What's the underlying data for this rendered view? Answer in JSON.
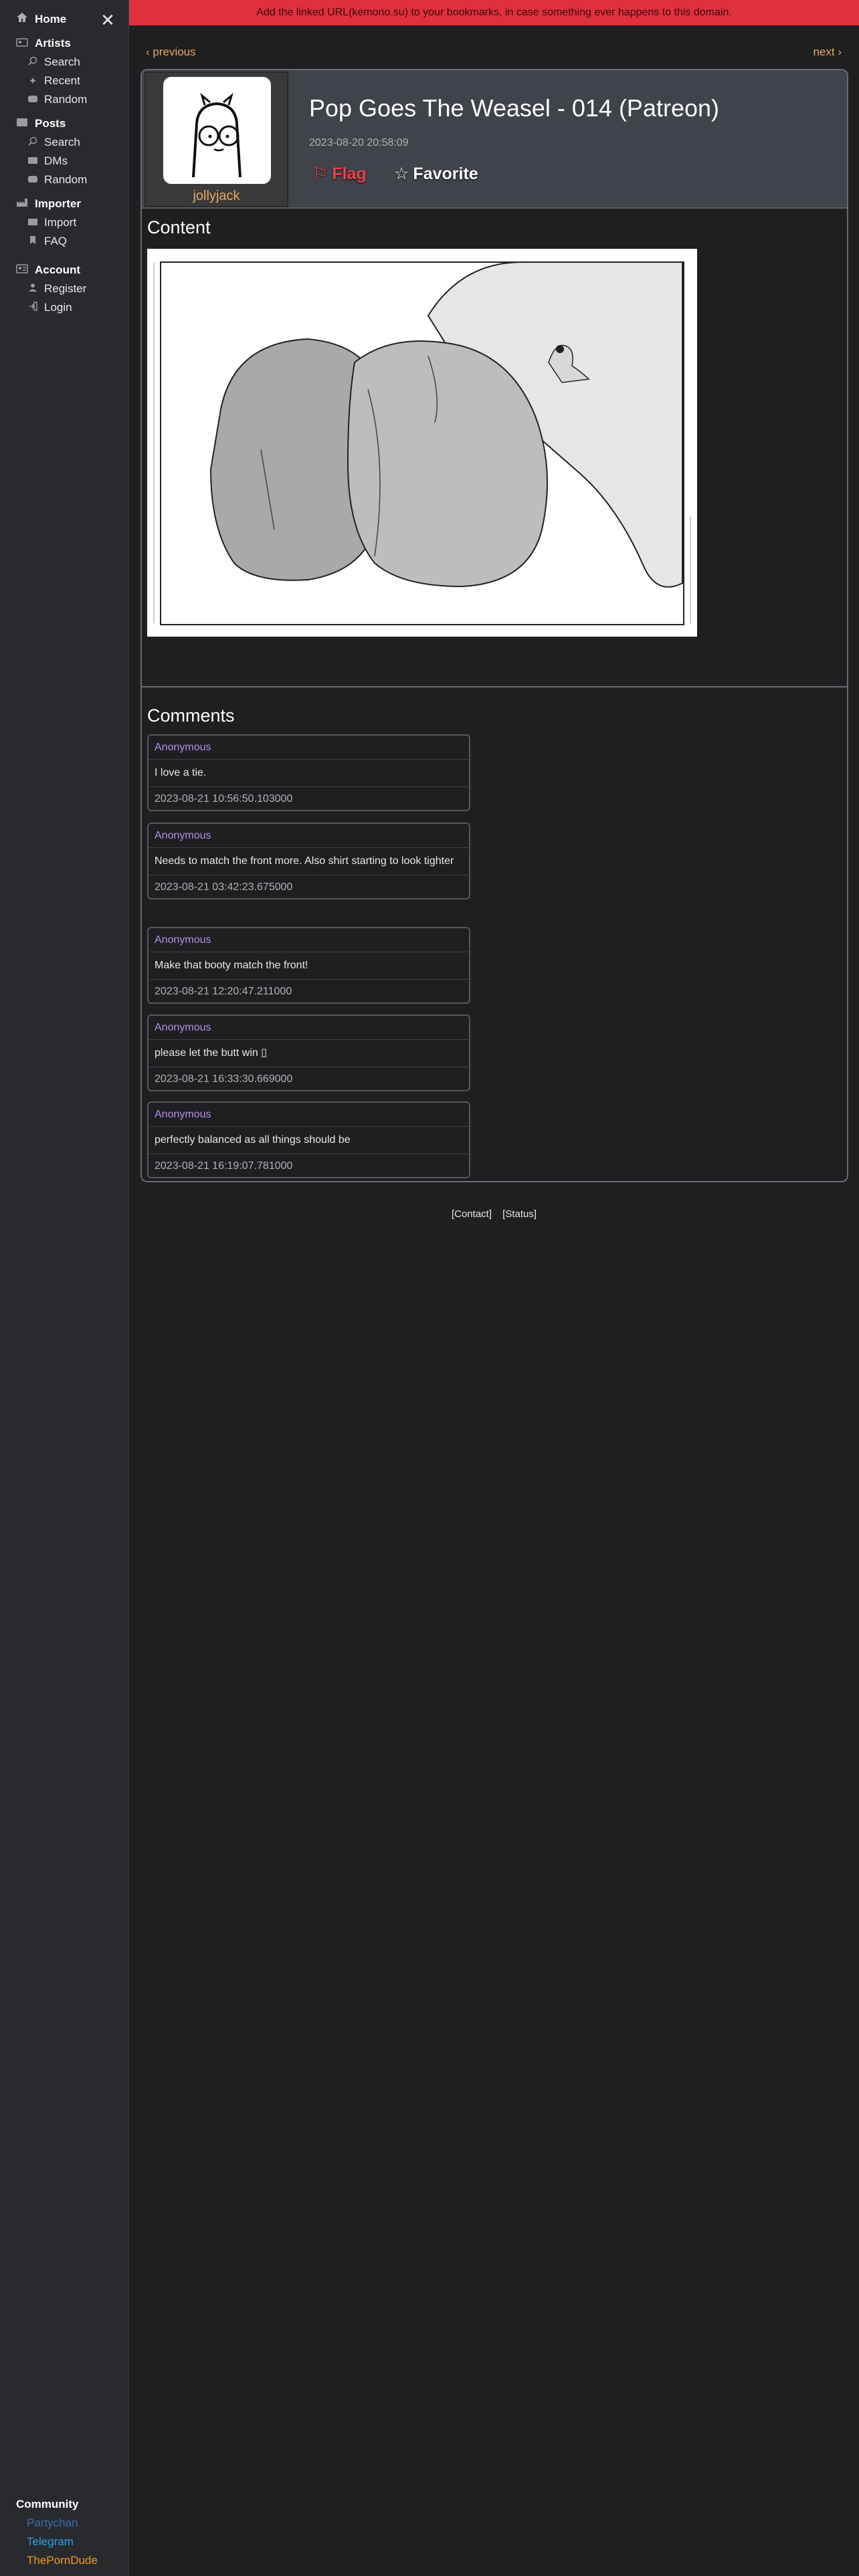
{
  "banner": {
    "text": "Add the linked URL(kemono.su) to your bookmarks, in case something ever happens to this domain."
  },
  "sidebar": {
    "home": "Home",
    "sections": [
      {
        "label": "Artists",
        "items": [
          "Search",
          "Recent",
          "Random"
        ]
      },
      {
        "label": "Posts",
        "items": [
          "Search",
          "DMs",
          "Random"
        ]
      },
      {
        "label": "Importer",
        "items": [
          "Import",
          "FAQ"
        ]
      },
      {
        "label": "Account",
        "items": [
          "Register",
          "Login"
        ]
      }
    ],
    "community": {
      "title": "Community",
      "links": [
        {
          "label": "Partychan",
          "color": "#3b6fae"
        },
        {
          "label": "Telegram",
          "color": "#2aa3e8"
        },
        {
          "label": "ThePornDude",
          "color": "#f39a1f"
        }
      ]
    }
  },
  "nav": {
    "previous": "‹ previous",
    "next": "next ›"
  },
  "post": {
    "username": "jollyjack",
    "title": "Pop Goes The Weasel - 014 (Patreon)",
    "date": "2023-08-20 20:58:09",
    "flag_label": "Flag",
    "favorite_label": "Favorite",
    "content_heading": "Content",
    "comments_heading": "Comments"
  },
  "comments": [
    {
      "author": "Anonymous",
      "body": "I love a tie.",
      "date": "2023-08-21 10:56:50.103000"
    },
    {
      "author": "Anonymous",
      "body": "Needs to match the front more. Also shirt starting to look tighter",
      "date": "2023-08-21 03:42:23.675000"
    },
    {
      "author": "Anonymous",
      "body": "Make that booty match the front!",
      "date": "2023-08-21 12:20:47.211000"
    },
    {
      "author": "Anonymous",
      "body": "please let the butt win ▯",
      "date": "2023-08-21 16:33:30.669000"
    },
    {
      "author": "Anonymous",
      "body": "perfectly balanced as all things should be",
      "date": "2023-08-21 16:19:07.781000"
    }
  ],
  "footer": {
    "contact": "[Contact]",
    "status": "[Status]"
  }
}
